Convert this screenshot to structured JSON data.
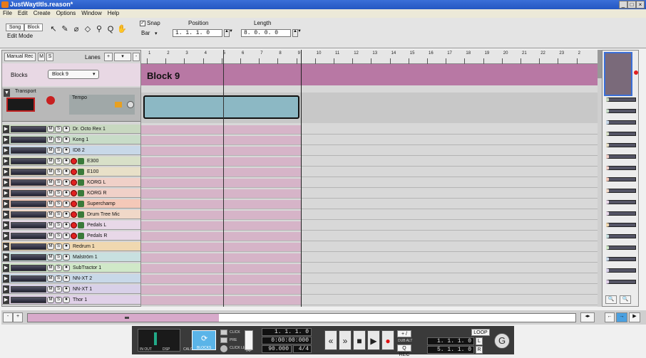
{
  "window": {
    "title": "JustWaytItIs.reason*",
    "min": "_",
    "max": "□",
    "close": "×"
  },
  "menu": [
    "File",
    "Edit",
    "Create",
    "Options",
    "Window",
    "Help"
  ],
  "toolbar": {
    "song_label": "Song",
    "block_label": "Block",
    "edit_mode_label": "Edit Mode",
    "tools": [
      "↖",
      "✎",
      "⌀",
      "◇",
      "⚲",
      "Q",
      "✋"
    ],
    "snap_label": "Snap",
    "snap_value": "Bar",
    "position_label": "Position",
    "position_value": "1. 1. 1.   0",
    "length_label": "Length",
    "length_value": "8. 0. 0.   0"
  },
  "left_panel": {
    "manual_rec": "Manual Rec",
    "m": "M",
    "s": "S",
    "lanes_label": "Lanes",
    "blocks_label": "Blocks",
    "blocks_value": "Block 9",
    "transport_label": "Transport",
    "tempo_label": "Tempo"
  },
  "tracks": [
    {
      "name": "Dr. Octo Rex 1",
      "color": "#c8d8c0",
      "rec": false
    },
    {
      "name": "Kong 1",
      "color": "#c8dcc8",
      "rec": false
    },
    {
      "name": "ID8 2",
      "color": "#c8d8e8",
      "rec": false
    },
    {
      "name": "E300",
      "color": "#d8e0c8",
      "rec": true
    },
    {
      "name": "E100",
      "color": "#e8e0c8",
      "rec": true
    },
    {
      "name": "KORG L",
      "color": "#f0d0c8",
      "rec": true
    },
    {
      "name": "KORG R",
      "color": "#f0d0c8",
      "rec": true
    },
    {
      "name": "Superchamp",
      "color": "#f4c8b8",
      "rec": true
    },
    {
      "name": "Drum Tree Mic",
      "color": "#f0d8c8",
      "rec": true
    },
    {
      "name": "Pedals L",
      "color": "#e8d8e8",
      "rec": true
    },
    {
      "name": "Pedals R",
      "color": "#e8d8e8",
      "rec": true
    },
    {
      "name": "Redrum 1",
      "color": "#f0d8b0",
      "rec": false
    },
    {
      "name": "Malström 1",
      "color": "#c8e0e0",
      "rec": false
    },
    {
      "name": "SubTractor 1",
      "color": "#d0e8c8",
      "rec": false
    },
    {
      "name": "NN-XT 2",
      "color": "#c8d8e8",
      "rec": false
    },
    {
      "name": "NN-XT 1",
      "color": "#d8d0e8",
      "rec": false
    },
    {
      "name": "Thor 1",
      "color": "#e0d0e8",
      "rec": false
    }
  ],
  "ruler": {
    "bars": [
      "1",
      "2",
      "3",
      "4",
      "5",
      "6",
      "7",
      "8",
      "9",
      "10",
      "11",
      "12",
      "13",
      "14",
      "15",
      "16",
      "17",
      "18",
      "19",
      "20",
      "21",
      "22",
      "23",
      "2"
    ]
  },
  "block_title": "Block 9",
  "transport": {
    "click_label": "CLICK",
    "pre_label": "PRE",
    "click_level": "CLICK LEVEL",
    "blocks_label": "BLOCKS",
    "tap_label": "TAP",
    "position": "1. 1. 1.   0",
    "time": "0:00:00:000",
    "tempo": "90.000",
    "signature": "4/4",
    "loop_label": "LOOP",
    "dub_alt": "DUB ALT",
    "q_rec": "Q REC",
    "left_loc": "1. 1. 1.   0",
    "right_loc": "5. 1. 1.   0",
    "l": "L",
    "r": "R",
    "in_out": "IN OUT",
    "dsp": "DSP",
    "calc": "CALC",
    "rewind": "«",
    "ffwd": "»",
    "stop": "■",
    "play": "▶",
    "rec": "●"
  },
  "colors": {
    "block_pink": "#b878a4",
    "clip_blue": "#8cb8c4",
    "titlebar": "#2457c2"
  }
}
